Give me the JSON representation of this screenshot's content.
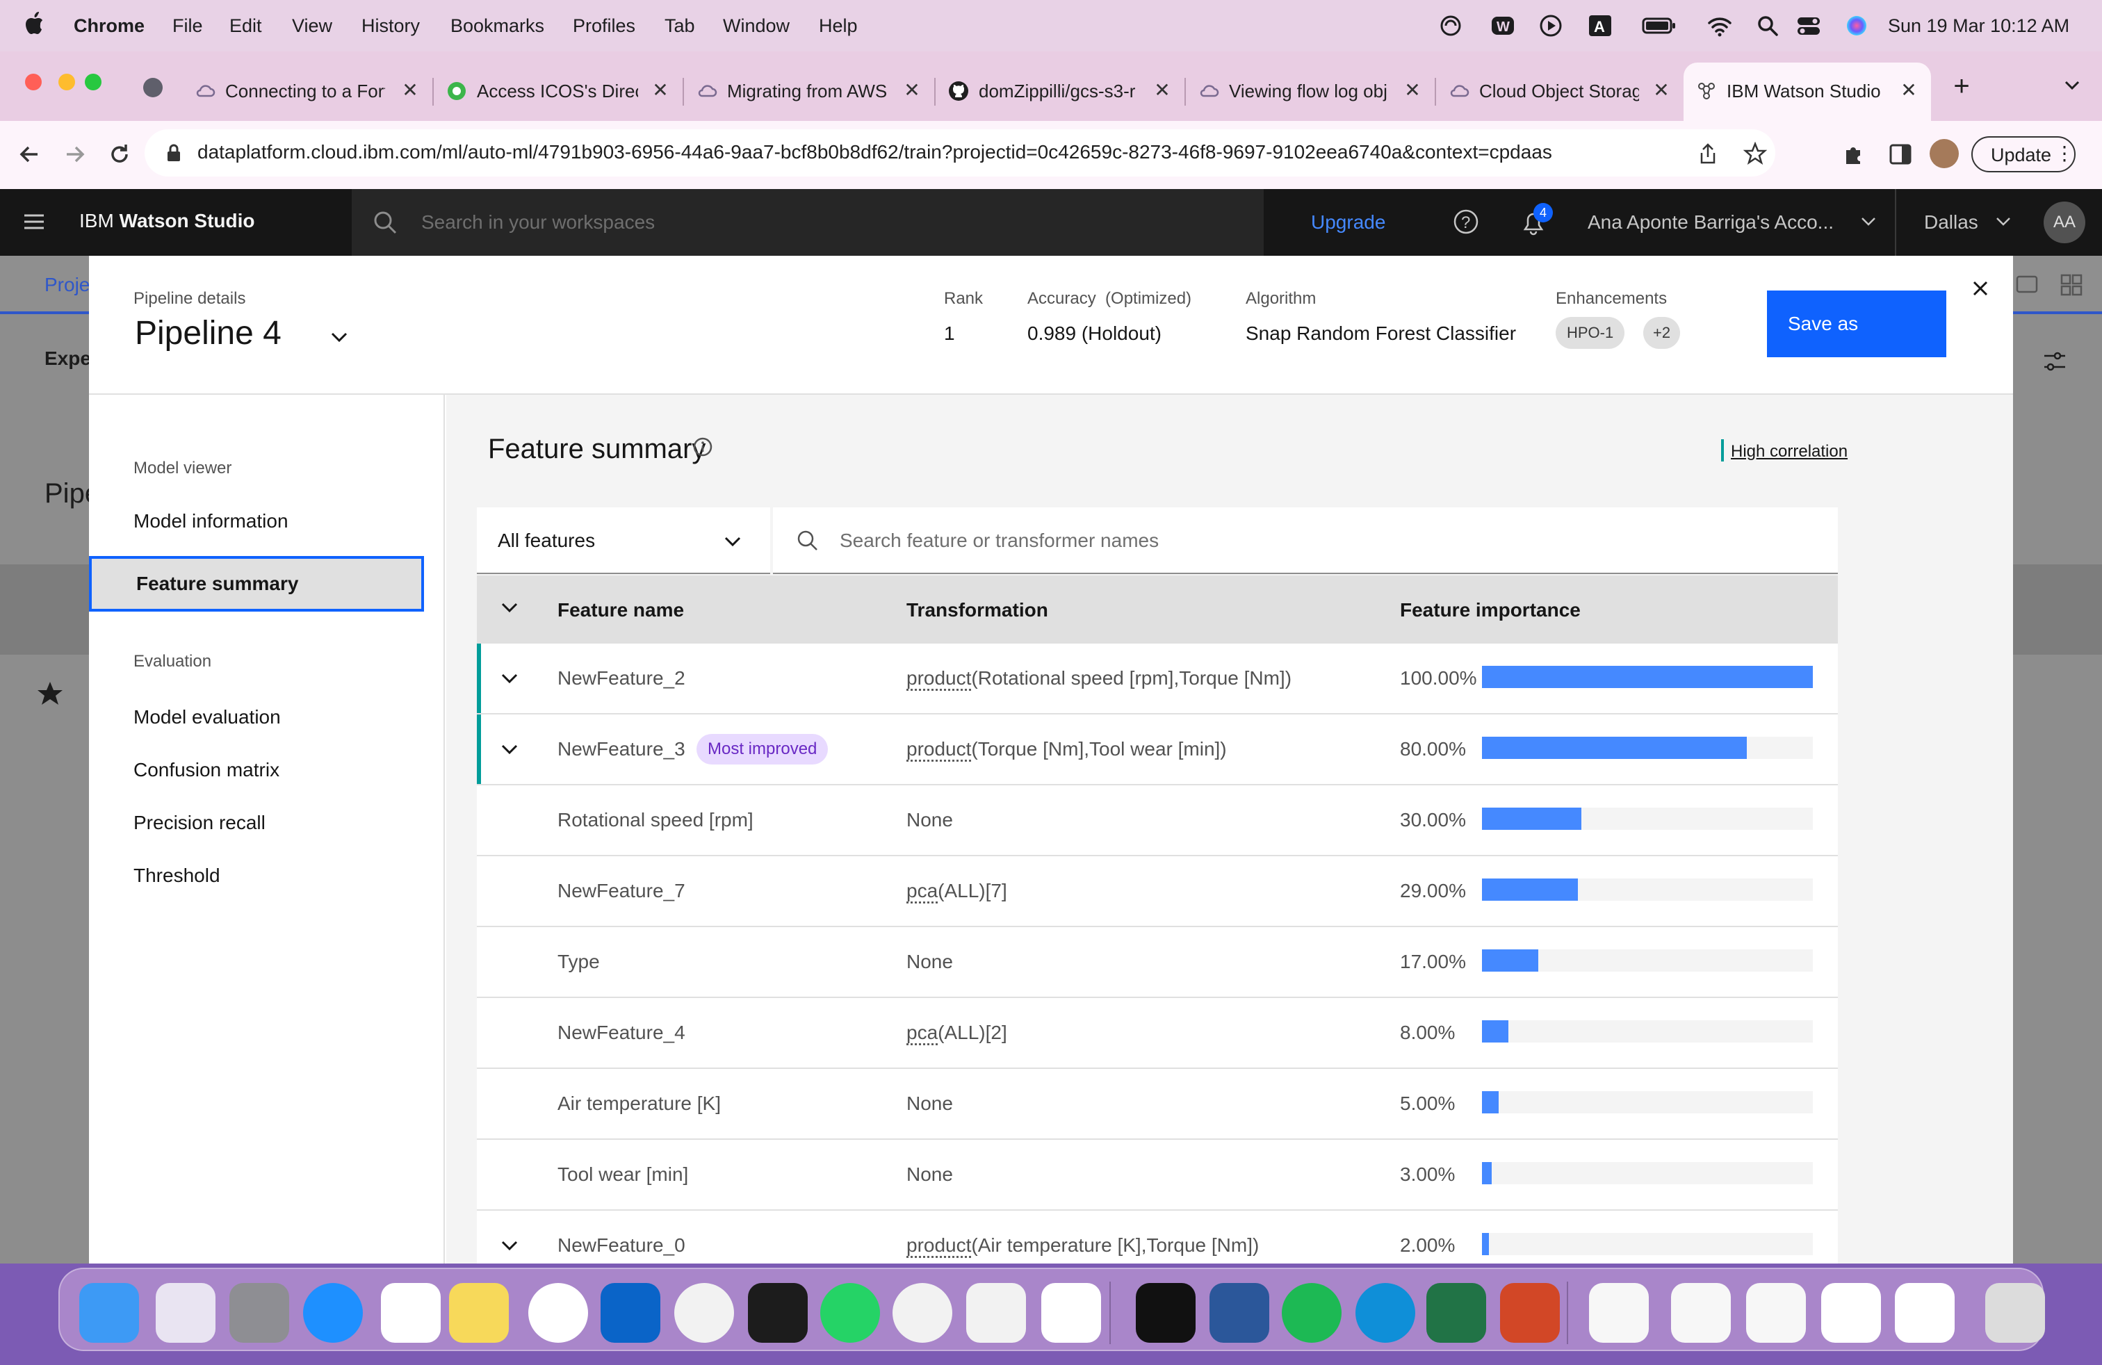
{
  "menubar": {
    "app": "Chrome",
    "items": [
      "File",
      "Edit",
      "View",
      "History",
      "Bookmarks",
      "Profiles",
      "Tab",
      "Window",
      "Help"
    ],
    "datetime": "Sun 19 Mar  10:12 AM"
  },
  "tabs": [
    {
      "title": "Connecting to a Fort"
    },
    {
      "title": "Access ICOS's Direc"
    },
    {
      "title": "Migrating from AWS"
    },
    {
      "title": "domZippilli/gcs-s3-r"
    },
    {
      "title": "Viewing flow log obj"
    },
    {
      "title": "Cloud Object Storag"
    },
    {
      "title": "IBM Watson Studio"
    }
  ],
  "toolbar": {
    "url": "dataplatform.cloud.ibm.com/ml/auto-ml/4791b903-6956-44a6-9aa7-bcf8b0b8df62/train?projectid=0c42659c-8273-46f8-9697-9102eea6740a&context=cpdaas",
    "update_label": "Update"
  },
  "ibm_header": {
    "brand_prefix": "IBM",
    "brand_name": "Watson Studio",
    "search_placeholder": "Search in your workspaces",
    "upgrade": "Upgrade",
    "notification_count": "4",
    "account": "Ana Aponte Barriga's Acco...",
    "region": "Dallas",
    "avatar_initials": "AA"
  },
  "background_page": {
    "tab_fragment": "Proje",
    "subheader_fragment": "Expe",
    "title_fragment": "Pipe",
    "right_fragment": "e"
  },
  "modal": {
    "details_label": "Pipeline details",
    "pipeline_name": "Pipeline 4",
    "rank_label": "Rank",
    "rank_value": "1",
    "accuracy_label": "Accuracy  (Optimized)",
    "accuracy_value": "0.989 (Holdout)",
    "algorithm_label": "Algorithm",
    "algorithm_value": "Snap Random Forest Classifier",
    "enhancements_label": "Enhancements",
    "enhancement_tags": [
      "HPO-1",
      "+2"
    ],
    "save_as_label": "Save as"
  },
  "leftnav": {
    "section1": "Model viewer",
    "items1": [
      "Model information",
      "Feature summary"
    ],
    "selected": "Feature summary",
    "section2": "Evaluation",
    "items2": [
      "Model evaluation",
      "Confusion matrix",
      "Precision recall",
      "Threshold"
    ]
  },
  "feature_summary": {
    "title": "Feature summary",
    "legend": "High correlation",
    "filter_value": "All features",
    "search_placeholder": "Search feature or transformer names",
    "columns": [
      "Feature name",
      "Transformation",
      "Feature importance"
    ],
    "rows": [
      {
        "name": "NewFeature_2",
        "badge": "",
        "fn": "product",
        "args": "(Rotational speed [rpm],Torque [Nm])",
        "importance": "100.00%",
        "pct": 100,
        "expandable": true,
        "highlight": true
      },
      {
        "name": "NewFeature_3",
        "badge": "Most improved",
        "fn": "product",
        "args": "(Torque [Nm],Tool wear [min])",
        "importance": "80.00%",
        "pct": 80,
        "expandable": true,
        "highlight": true
      },
      {
        "name": "Rotational speed [rpm]",
        "badge": "",
        "fn": "",
        "args": "None",
        "importance": "30.00%",
        "pct": 30,
        "expandable": false,
        "highlight": false
      },
      {
        "name": "NewFeature_7",
        "badge": "",
        "fn": "pca",
        "args": "(ALL)[7]",
        "importance": "29.00%",
        "pct": 29,
        "expandable": false,
        "highlight": false
      },
      {
        "name": "Type",
        "badge": "",
        "fn": "",
        "args": "None",
        "importance": "17.00%",
        "pct": 17,
        "expandable": false,
        "highlight": false
      },
      {
        "name": "NewFeature_4",
        "badge": "",
        "fn": "pca",
        "args": "(ALL)[2]",
        "importance": "8.00%",
        "pct": 8,
        "expandable": false,
        "highlight": false
      },
      {
        "name": "Air temperature [K]",
        "badge": "",
        "fn": "",
        "args": "None",
        "importance": "5.00%",
        "pct": 5,
        "expandable": false,
        "highlight": false
      },
      {
        "name": "Tool wear [min]",
        "badge": "",
        "fn": "",
        "args": "None",
        "importance": "3.00%",
        "pct": 3,
        "expandable": false,
        "highlight": false
      },
      {
        "name": "NewFeature_0",
        "badge": "",
        "fn": "product",
        "args": "(Air temperature [K],Torque [Nm])",
        "importance": "2.00%",
        "pct": 2,
        "expandable": true,
        "highlight": false
      }
    ]
  },
  "colors": {
    "accent": "#0f62fe",
    "bar": "#4589ff",
    "highlight": "#009d9a",
    "badge_bg": "#e8daff",
    "badge_fg": "#6929c4"
  },
  "dock_icons": [
    "finder-icon",
    "launchpad-icon",
    "system-settings-icon",
    "safari-icon",
    "reminders-icon",
    "notes-icon",
    "slack-icon",
    "outlook-icon",
    "activity-monitor-icon",
    "terminal-icon",
    "whatsapp-icon",
    "chrome-icon",
    "script-editor-icon",
    "vscode-icon",
    "webex-icon",
    "word-icon",
    "spotify-icon",
    "edge-icon",
    "excel-icon",
    "powerpoint-icon",
    "document-icon",
    "screenshot-1-icon",
    "screenshot-2-icon",
    "screenshot-3-icon",
    "screenshot-4-icon",
    "trash-icon"
  ]
}
